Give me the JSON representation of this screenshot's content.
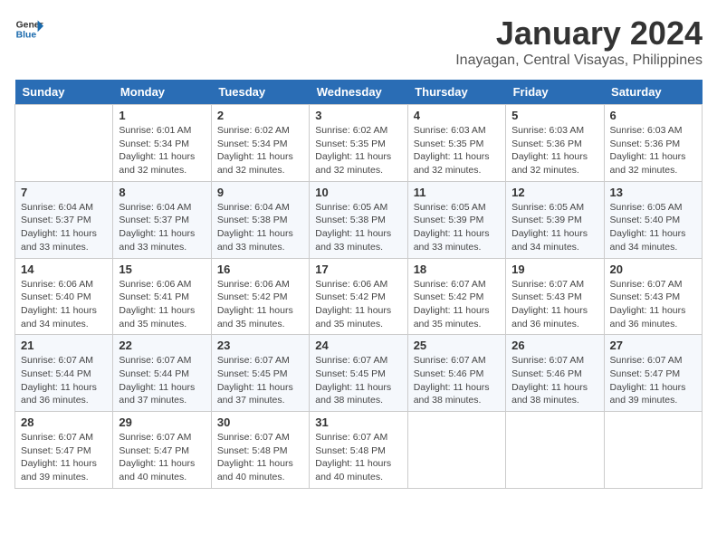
{
  "logo": {
    "text_general": "General",
    "text_blue": "Blue"
  },
  "title": "January 2024",
  "location": "Inayagan, Central Visayas, Philippines",
  "days_of_week": [
    "Sunday",
    "Monday",
    "Tuesday",
    "Wednesday",
    "Thursday",
    "Friday",
    "Saturday"
  ],
  "weeks": [
    [
      {
        "day": "",
        "info": ""
      },
      {
        "day": "1",
        "info": "Sunrise: 6:01 AM\nSunset: 5:34 PM\nDaylight: 11 hours\nand 32 minutes."
      },
      {
        "day": "2",
        "info": "Sunrise: 6:02 AM\nSunset: 5:34 PM\nDaylight: 11 hours\nand 32 minutes."
      },
      {
        "day": "3",
        "info": "Sunrise: 6:02 AM\nSunset: 5:35 PM\nDaylight: 11 hours\nand 32 minutes."
      },
      {
        "day": "4",
        "info": "Sunrise: 6:03 AM\nSunset: 5:35 PM\nDaylight: 11 hours\nand 32 minutes."
      },
      {
        "day": "5",
        "info": "Sunrise: 6:03 AM\nSunset: 5:36 PM\nDaylight: 11 hours\nand 32 minutes."
      },
      {
        "day": "6",
        "info": "Sunrise: 6:03 AM\nSunset: 5:36 PM\nDaylight: 11 hours\nand 32 minutes."
      }
    ],
    [
      {
        "day": "7",
        "info": "Sunrise: 6:04 AM\nSunset: 5:37 PM\nDaylight: 11 hours\nand 33 minutes."
      },
      {
        "day": "8",
        "info": "Sunrise: 6:04 AM\nSunset: 5:37 PM\nDaylight: 11 hours\nand 33 minutes."
      },
      {
        "day": "9",
        "info": "Sunrise: 6:04 AM\nSunset: 5:38 PM\nDaylight: 11 hours\nand 33 minutes."
      },
      {
        "day": "10",
        "info": "Sunrise: 6:05 AM\nSunset: 5:38 PM\nDaylight: 11 hours\nand 33 minutes."
      },
      {
        "day": "11",
        "info": "Sunrise: 6:05 AM\nSunset: 5:39 PM\nDaylight: 11 hours\nand 33 minutes."
      },
      {
        "day": "12",
        "info": "Sunrise: 6:05 AM\nSunset: 5:39 PM\nDaylight: 11 hours\nand 34 minutes."
      },
      {
        "day": "13",
        "info": "Sunrise: 6:05 AM\nSunset: 5:40 PM\nDaylight: 11 hours\nand 34 minutes."
      }
    ],
    [
      {
        "day": "14",
        "info": "Sunrise: 6:06 AM\nSunset: 5:40 PM\nDaylight: 11 hours\nand 34 minutes."
      },
      {
        "day": "15",
        "info": "Sunrise: 6:06 AM\nSunset: 5:41 PM\nDaylight: 11 hours\nand 35 minutes."
      },
      {
        "day": "16",
        "info": "Sunrise: 6:06 AM\nSunset: 5:42 PM\nDaylight: 11 hours\nand 35 minutes."
      },
      {
        "day": "17",
        "info": "Sunrise: 6:06 AM\nSunset: 5:42 PM\nDaylight: 11 hours\nand 35 minutes."
      },
      {
        "day": "18",
        "info": "Sunrise: 6:07 AM\nSunset: 5:42 PM\nDaylight: 11 hours\nand 35 minutes."
      },
      {
        "day": "19",
        "info": "Sunrise: 6:07 AM\nSunset: 5:43 PM\nDaylight: 11 hours\nand 36 minutes."
      },
      {
        "day": "20",
        "info": "Sunrise: 6:07 AM\nSunset: 5:43 PM\nDaylight: 11 hours\nand 36 minutes."
      }
    ],
    [
      {
        "day": "21",
        "info": "Sunrise: 6:07 AM\nSunset: 5:44 PM\nDaylight: 11 hours\nand 36 minutes."
      },
      {
        "day": "22",
        "info": "Sunrise: 6:07 AM\nSunset: 5:44 PM\nDaylight: 11 hours\nand 37 minutes."
      },
      {
        "day": "23",
        "info": "Sunrise: 6:07 AM\nSunset: 5:45 PM\nDaylight: 11 hours\nand 37 minutes."
      },
      {
        "day": "24",
        "info": "Sunrise: 6:07 AM\nSunset: 5:45 PM\nDaylight: 11 hours\nand 38 minutes."
      },
      {
        "day": "25",
        "info": "Sunrise: 6:07 AM\nSunset: 5:46 PM\nDaylight: 11 hours\nand 38 minutes."
      },
      {
        "day": "26",
        "info": "Sunrise: 6:07 AM\nSunset: 5:46 PM\nDaylight: 11 hours\nand 38 minutes."
      },
      {
        "day": "27",
        "info": "Sunrise: 6:07 AM\nSunset: 5:47 PM\nDaylight: 11 hours\nand 39 minutes."
      }
    ],
    [
      {
        "day": "28",
        "info": "Sunrise: 6:07 AM\nSunset: 5:47 PM\nDaylight: 11 hours\nand 39 minutes."
      },
      {
        "day": "29",
        "info": "Sunrise: 6:07 AM\nSunset: 5:47 PM\nDaylight: 11 hours\nand 40 minutes."
      },
      {
        "day": "30",
        "info": "Sunrise: 6:07 AM\nSunset: 5:48 PM\nDaylight: 11 hours\nand 40 minutes."
      },
      {
        "day": "31",
        "info": "Sunrise: 6:07 AM\nSunset: 5:48 PM\nDaylight: 11 hours\nand 40 minutes."
      },
      {
        "day": "",
        "info": ""
      },
      {
        "day": "",
        "info": ""
      },
      {
        "day": "",
        "info": ""
      }
    ]
  ]
}
